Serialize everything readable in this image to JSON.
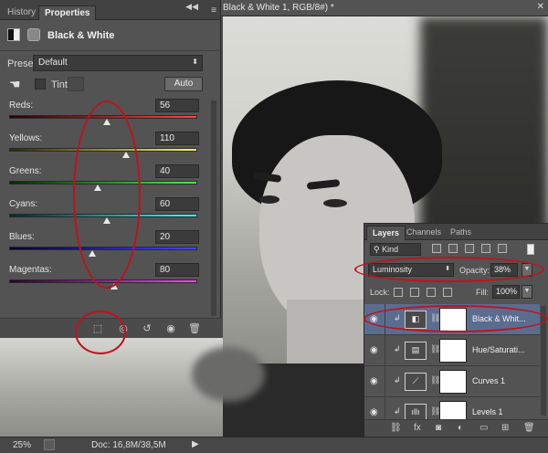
{
  "document": {
    "title": "Black & White 1, RGB/8#) *"
  },
  "status": {
    "zoom": "25%",
    "doc": "Doc: 16,8M/38,5M",
    "arrow": "▶"
  },
  "properties": {
    "tabs": [
      "History",
      "Properties"
    ],
    "active_tab": "Properties",
    "title": "Black & White",
    "preset_label": "Preset:",
    "preset_value": "Default",
    "tint_label": "Tint",
    "auto_label": "Auto",
    "sliders": [
      {
        "label": "Reds:",
        "value": "56",
        "color_from": "#2a0000",
        "color_to": "#ff4646",
        "pos": 0.52
      },
      {
        "label": "Yellows:",
        "value": "110",
        "color_from": "#2a2a00",
        "color_to": "#ffff44",
        "pos": 0.62
      },
      {
        "label": "Greens:",
        "value": "40",
        "color_from": "#002a00",
        "color_to": "#44ff44",
        "pos": 0.47
      },
      {
        "label": "Cyans:",
        "value": "60",
        "color_from": "#002a2a",
        "color_to": "#44ffff",
        "pos": 0.52
      },
      {
        "label": "Blues:",
        "value": "20",
        "color_from": "#00002a",
        "color_to": "#4646ff",
        "pos": 0.44
      },
      {
        "label": "Magentas:",
        "value": "80",
        "color_from": "#2a002a",
        "color_to": "#ff44ff",
        "pos": 0.56
      }
    ]
  },
  "layers": {
    "tabs": [
      "Layers",
      "Channels",
      "Paths"
    ],
    "active_tab": "Layers",
    "kind": "Kind",
    "blend_mode": "Luminosity",
    "opacity_label": "Opacity:",
    "opacity_value": "38%",
    "lock_label": "Lock:",
    "fill_label": "Fill:",
    "fill_value": "100%",
    "items": [
      {
        "name": "Black & Whit...",
        "adj_icon": "◧",
        "selected": true
      },
      {
        "name": "Hue/Saturati...",
        "adj_icon": "▤",
        "selected": false
      },
      {
        "name": "Curves 1",
        "adj_icon": "⟋",
        "selected": false
      },
      {
        "name": "Levels 1",
        "adj_icon": "ıllı",
        "selected": false
      }
    ]
  },
  "colors": {
    "annotation": "#c0121b",
    "selection": "#5b6d8f"
  }
}
